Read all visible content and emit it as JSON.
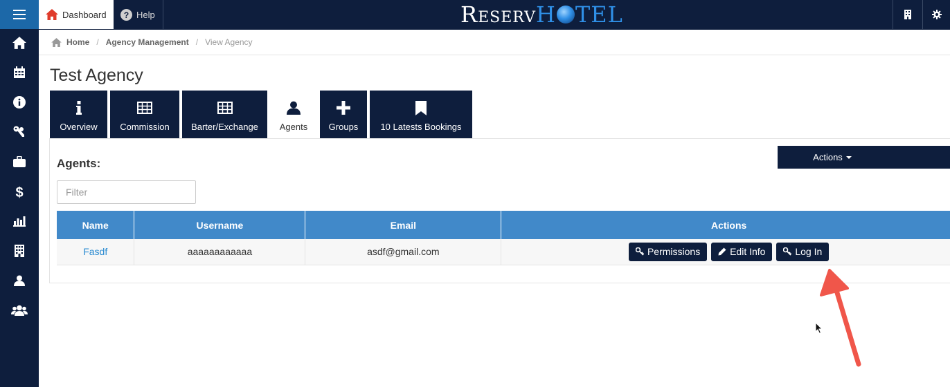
{
  "topbar": {
    "menu_icon": "hamburger-icon",
    "dashboard_label": "Dashboard",
    "help_label": "Help",
    "logo_part1": "Reserv",
    "logo_part2": "H",
    "logo_part3": "TEL",
    "right_icons": [
      "building-icon",
      "gear-icon"
    ]
  },
  "sidebar": {
    "items": [
      "home-icon",
      "calendar-icon",
      "info-icon",
      "key-icon",
      "briefcase-icon",
      "dollar-icon",
      "bar-chart-icon",
      "hotel-building-icon",
      "user-icon",
      "users-icon"
    ]
  },
  "breadcrumb": {
    "home": "Home",
    "agency_management": "Agency Management",
    "current": "View Agency"
  },
  "page": {
    "title": "Test Agency"
  },
  "tabs": [
    {
      "label": "Overview",
      "icon": "info-icon"
    },
    {
      "label": "Commission",
      "icon": "table-icon"
    },
    {
      "label": "Barter/Exchange",
      "icon": "table-icon"
    },
    {
      "label": "Agents",
      "icon": "user-icon",
      "active": true
    },
    {
      "label": "Groups",
      "icon": "plus-icon"
    },
    {
      "label": "10 Latests Bookings",
      "icon": "bookmark-icon"
    }
  ],
  "agents": {
    "heading": "Agents:",
    "actions_label": "Actions",
    "filter_placeholder": "Filter",
    "columns": [
      "Name",
      "Username",
      "Email",
      "Actions"
    ],
    "rows": [
      {
        "name": "Fasdf",
        "username": "aaaaaaaaaaaa",
        "email": "asdf@gmail.com",
        "buttons": [
          "Permissions",
          "Edit Info",
          "Log In"
        ]
      }
    ]
  },
  "colors": {
    "navy": "#0e1e3d",
    "blue_header": "#4189c9",
    "hamburger_bg": "#1c68a8",
    "link": "#2a8bd1",
    "annotation_arrow": "#f0564a"
  }
}
